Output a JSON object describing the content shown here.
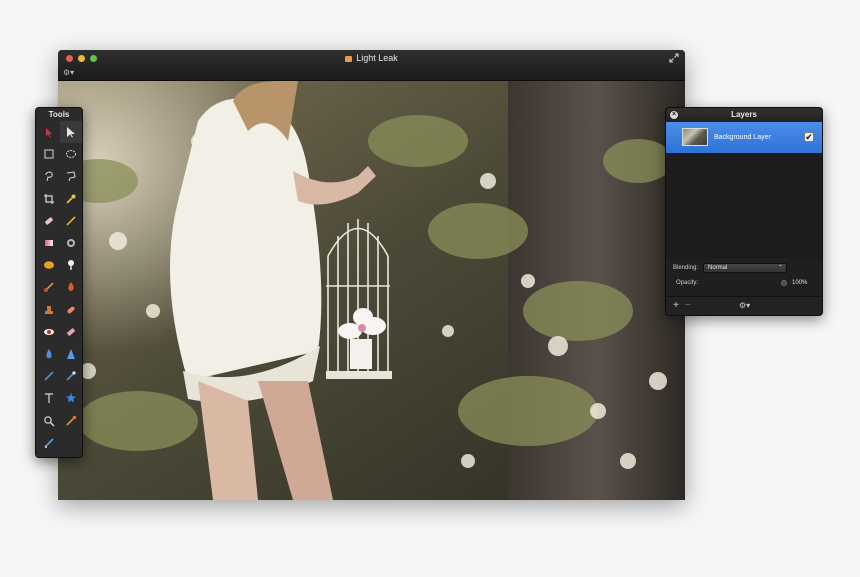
{
  "window": {
    "title": "Light Leak",
    "settings_menu": "⚙▾"
  },
  "tools": {
    "title": "Tools",
    "items": [
      {
        "name": "move-tool",
        "label": "Move",
        "active": false
      },
      {
        "name": "pointer-tool",
        "label": "Select",
        "active": true
      },
      {
        "name": "rect-select-tool",
        "label": "Rectangular Select",
        "active": false
      },
      {
        "name": "ellipse-select-tool",
        "label": "Elliptical Select",
        "active": false
      },
      {
        "name": "lasso-tool",
        "label": "Lasso",
        "active": false
      },
      {
        "name": "polygon-lasso-tool",
        "label": "Polygonal Lasso",
        "active": false
      },
      {
        "name": "crop-tool",
        "label": "Crop",
        "active": false
      },
      {
        "name": "eyedropper-tool",
        "label": "Color Picker",
        "active": false
      },
      {
        "name": "eraser-tool",
        "label": "Eraser",
        "active": false
      },
      {
        "name": "pencil-tool",
        "label": "Pencil",
        "active": false
      },
      {
        "name": "gradient-tool",
        "label": "Gradient",
        "active": false
      },
      {
        "name": "fill-tool",
        "label": "Fill",
        "active": false
      },
      {
        "name": "blob-tool",
        "label": "Shape",
        "active": false
      },
      {
        "name": "smudge-tool",
        "label": "Smudge",
        "active": false
      },
      {
        "name": "brush-tool",
        "label": "Brush",
        "active": false
      },
      {
        "name": "burn-tool",
        "label": "Burn",
        "active": false
      },
      {
        "name": "stamp-tool",
        "label": "Clone Stamp",
        "active": false
      },
      {
        "name": "heal-tool",
        "label": "Heal",
        "active": false
      },
      {
        "name": "redeye-tool",
        "label": "Red Eye",
        "active": false
      },
      {
        "name": "eraser2-tool",
        "label": "Erase",
        "active": false
      },
      {
        "name": "blur-tool",
        "label": "Blur",
        "active": false
      },
      {
        "name": "sharpen-tool",
        "label": "Sharpen",
        "active": false
      },
      {
        "name": "line-tool",
        "label": "Line",
        "active": false
      },
      {
        "name": "pen-tool",
        "label": "Pen",
        "active": false
      },
      {
        "name": "text-tool",
        "label": "Text",
        "active": false
      },
      {
        "name": "shape-star-tool",
        "label": "Star Shape",
        "active": false
      },
      {
        "name": "zoom-tool",
        "label": "Zoom",
        "active": false
      },
      {
        "name": "color-brush-tool",
        "label": "Color Brush",
        "active": false
      },
      {
        "name": "knife-tool",
        "label": "Slice",
        "active": false
      }
    ]
  },
  "layers": {
    "title": "Layers",
    "close_icon": "×",
    "items": [
      {
        "name": "Background Layer",
        "visible_mark": "✔"
      }
    ],
    "blending_label": "Blending:",
    "blending_value": "Normal",
    "blending_caret": "⌃",
    "opacity_label": "Opacity:",
    "opacity_value": "100%",
    "footer": {
      "add": "+",
      "remove": "−",
      "settings": "⚙▾"
    }
  },
  "colors": {
    "accent": "#3a80e0",
    "panel_bg": "#2b2b2b",
    "titlebar_bg": "#232323"
  }
}
